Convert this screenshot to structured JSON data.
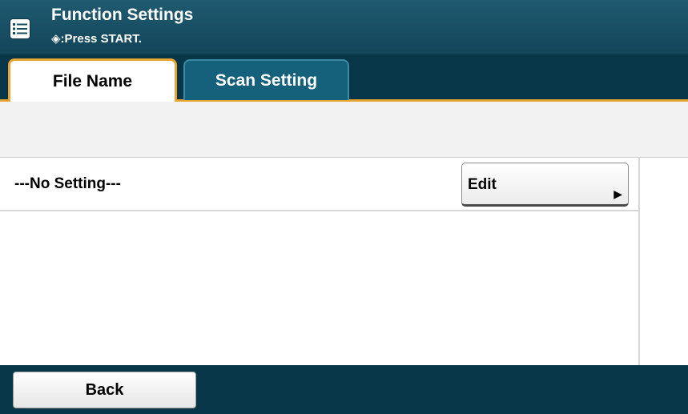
{
  "header": {
    "title": "Function Settings",
    "subtitle": "◈:Press START.",
    "menu_icon": "list-menu-icon"
  },
  "tabs": [
    {
      "label": "File Name",
      "active": true
    },
    {
      "label": "Scan Setting",
      "active": false
    }
  ],
  "list": {
    "rows": [
      {
        "label": "---No Setting---",
        "button_label": "Edit",
        "button_icon": "play-arrow-icon"
      }
    ]
  },
  "footer": {
    "back_label": "Back"
  },
  "colors": {
    "header_bg": "#134558",
    "tabbar_bg": "#063647",
    "accent": "#e8a531",
    "inactive_tab": "#15607a"
  }
}
